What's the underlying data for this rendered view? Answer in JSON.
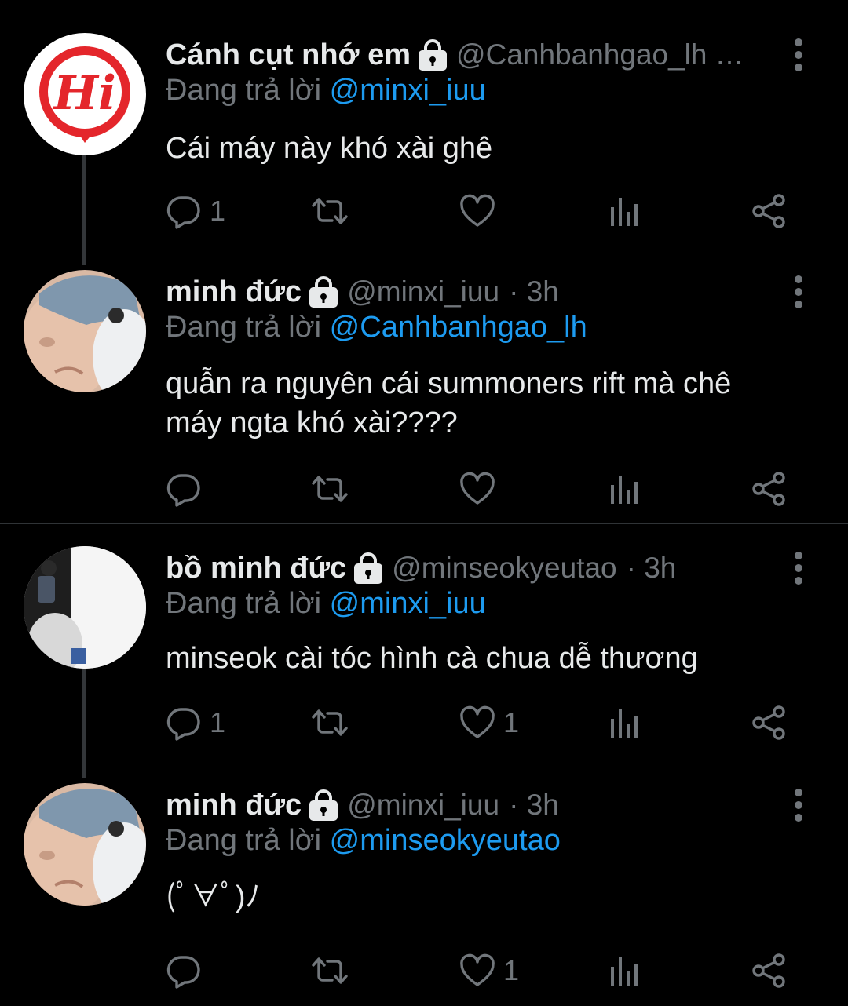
{
  "tweets": [
    {
      "display_name": "Cánh cụt nhớ em",
      "handle": "@Canhbanhgao_lh",
      "handle_suffix": "…",
      "time": "",
      "reply_prefix": "Đang trả lời",
      "reply_to": "@minxi_iuu",
      "body_lines": [
        "Cái máy này khó xài ghê"
      ],
      "reply_count": "1",
      "retweet_count": "",
      "like_count": "",
      "avatar_text": "Hi"
    },
    {
      "display_name": "minh đức",
      "handle": "@minxi_iuu",
      "handle_suffix": "",
      "time": "· 3h",
      "reply_prefix": "Đang trả lời",
      "reply_to": "@Canhbanhgao_lh",
      "body_lines": [
        "quẫn ra nguyên cái summoners rift mà chê",
        "máy ngta khó xài????"
      ],
      "reply_count": "",
      "retweet_count": "",
      "like_count": ""
    },
    {
      "display_name": "bồ minh đức",
      "handle": "@minseokyeutao",
      "handle_suffix": "",
      "time": "· 3h",
      "reply_prefix": "Đang trả lời",
      "reply_to": "@minxi_iuu",
      "body_lines": [
        "minseok cài tóc hình cà chua dễ thương"
      ],
      "reply_count": "1",
      "retweet_count": "",
      "like_count": "1"
    },
    {
      "display_name": "minh đức",
      "handle": "@minxi_iuu",
      "handle_suffix": "",
      "time": "· 3h",
      "reply_prefix": "Đang trả lời",
      "reply_to": "@minseokyeutao",
      "body_lines": [
        "(ﾟ∀ﾟ)ﾉ"
      ],
      "reply_count": "",
      "retweet_count": "",
      "like_count": "1"
    }
  ],
  "colors": {
    "background": "#000000",
    "text": "#e7e9ea",
    "muted": "#71767b",
    "link": "#1d9bf0",
    "brand_red": "#e4262b"
  },
  "icons": [
    "lock-icon",
    "more-icon",
    "reply-icon",
    "retweet-icon",
    "like-icon",
    "views-icon",
    "share-icon"
  ]
}
